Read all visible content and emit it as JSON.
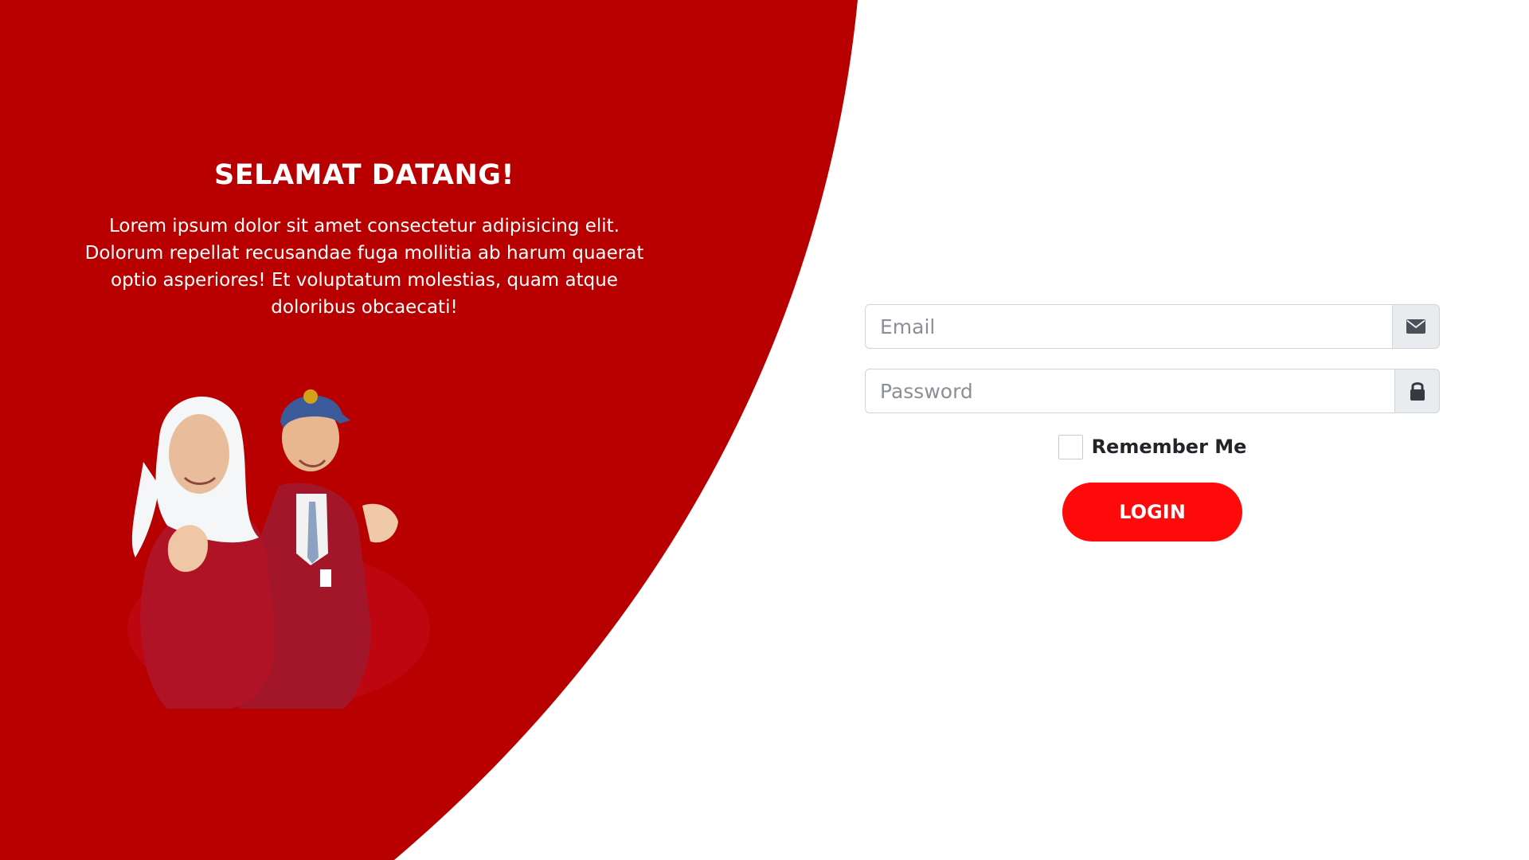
{
  "welcome": {
    "title": "SELAMAT DATANG!",
    "description": "Lorem ipsum dolor sit amet consectetur adipisicing elit. Dolorum repellat recusandae fuga mollitia ab harum quaerat optio asperiores! Et voluptatum molestias, quam atque doloribus obcaecati!"
  },
  "illustration": {
    "icon": "students-photo"
  },
  "login_form": {
    "email_placeholder": "Email",
    "email_value": "",
    "email_icon": "envelope-icon",
    "password_placeholder": "Password",
    "password_value": "",
    "password_icon": "lock-icon",
    "remember_label": "Remember Me",
    "remember_checked": false,
    "login_label": "LOGIN"
  },
  "colors": {
    "brand_red": "#b80000",
    "button_red": "#ff0a0a",
    "addon_gray": "#e9ecef",
    "border_gray": "#ced4da"
  }
}
